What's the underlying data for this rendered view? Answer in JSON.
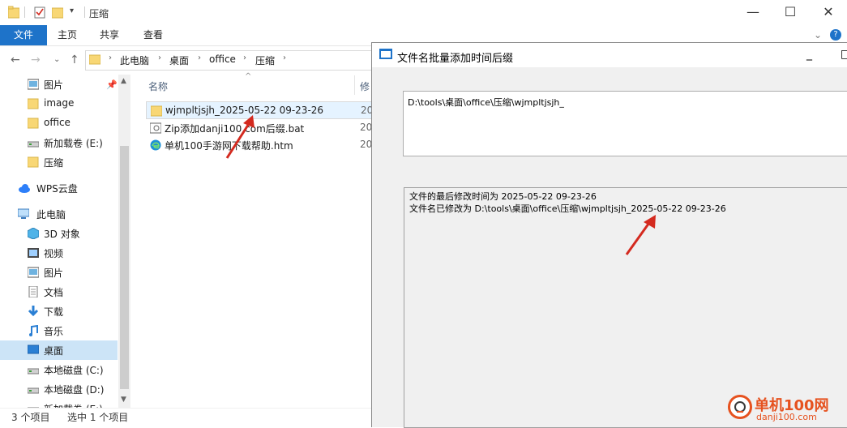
{
  "explorer": {
    "window_title": "压缩",
    "window_controls": {
      "minimize": "—",
      "maximize": "☐",
      "close": "✕"
    },
    "ribbon_tabs": {
      "file": "文件",
      "home": "主页",
      "share": "共享",
      "view": "查看"
    },
    "ribbon_expand": "⌄",
    "help": "?",
    "nav": {
      "back": "←",
      "forward": "→",
      "recent": "⌄",
      "up": "↑"
    },
    "breadcrumb": [
      "此电脑",
      "桌面",
      "office",
      "压缩"
    ],
    "sidebar": [
      {
        "label": "图片",
        "icon": "pictures-icon"
      },
      {
        "label": "image",
        "icon": "folder-icon"
      },
      {
        "label": "office",
        "icon": "folder-icon"
      },
      {
        "label": "新加载卷 (E:)",
        "icon": "drive-icon"
      },
      {
        "label": "压缩",
        "icon": "folder-icon"
      },
      {
        "label": "WPS云盘",
        "icon": "cloud-icon"
      },
      {
        "label": "此电脑",
        "icon": "computer-icon"
      },
      {
        "label": "3D 对象",
        "icon": "3d-objects-icon"
      },
      {
        "label": "视频",
        "icon": "video-icon"
      },
      {
        "label": "图片",
        "icon": "pictures-icon"
      },
      {
        "label": "文档",
        "icon": "documents-icon"
      },
      {
        "label": "下载",
        "icon": "download-icon"
      },
      {
        "label": "音乐",
        "icon": "music-icon"
      },
      {
        "label": "桌面",
        "icon": "desktop-icon"
      },
      {
        "label": "本地磁盘 (C:)",
        "icon": "drive-icon"
      },
      {
        "label": "本地磁盘 (D:)",
        "icon": "drive-icon"
      },
      {
        "label": "新加载卷 (E:)",
        "icon": "drive-icon"
      }
    ],
    "columns": {
      "name": "名称",
      "modified": "修"
    },
    "files": [
      {
        "name": "wjmpltjsjh_2025-05-22 09-23-26",
        "date": "20",
        "icon": "folder-icon",
        "selected": true
      },
      {
        "name": "Zip添加danji100.com后缀.bat",
        "date": "20",
        "icon": "batch-file-icon",
        "selected": false
      },
      {
        "name": "单机100手游网下载帮助.htm",
        "date": "20",
        "icon": "edge-html-icon",
        "selected": false
      }
    ],
    "status": {
      "count": "3 个项目",
      "selection": "选中 1 个项目"
    }
  },
  "dialog": {
    "title": "文件名批量添加时间后缀",
    "controls": {
      "minimize": "_",
      "maximize": "□"
    },
    "path_value": "D:\\tools\\桌面\\office\\压缩\\wjmpltjsjh_",
    "log": [
      "文件的最后修改时间为 2025-05-22 09-23-26",
      "文件名已修改为 D:\\tools\\桌面\\office\\压缩\\wjmpltjsjh_2025-05-22 09-23-26"
    ]
  },
  "watermark": {
    "brand": "单机100网",
    "url": "danji100.com"
  },
  "colors": {
    "accent": "#1e73c9",
    "selection": "#cce4f7",
    "arrow": "#d42a1f",
    "watermark": "#e6521f"
  }
}
